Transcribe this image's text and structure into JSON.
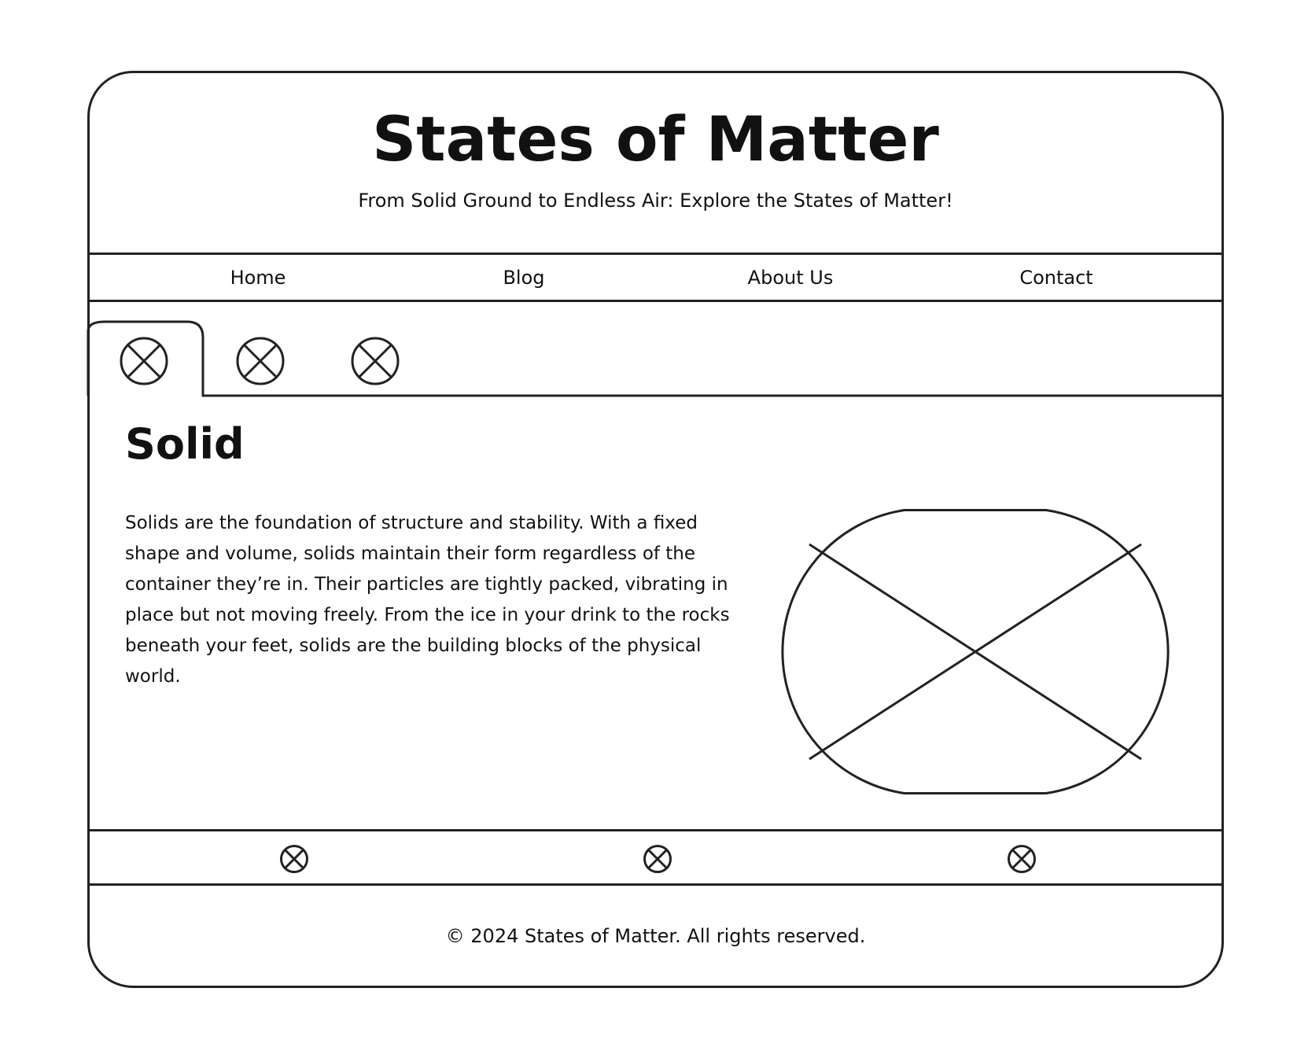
{
  "header": {
    "title": "States of Matter",
    "subtitle": "From Solid Ground to Endless Air: Explore the States of Matter!"
  },
  "nav": {
    "items": [
      {
        "label": "Home"
      },
      {
        "label": "Blog"
      },
      {
        "label": "About Us"
      },
      {
        "label": "Contact"
      }
    ]
  },
  "tabs": {
    "icons": [
      "placeholder-icon",
      "placeholder-icon",
      "placeholder-icon"
    ],
    "active_index": 0
  },
  "content": {
    "heading": "Solid",
    "body": "Solids are the foundation of structure and stability. With a fixed shape and volume, solids maintain their form regardless of the container they’re in. Their particles are tightly packed, vibrating in place but not moving freely. From the ice in your drink to the rocks beneath your feet, solids are the building blocks of the physical world.",
    "image_icon": "image-placeholder-icon"
  },
  "social": {
    "icons": [
      "placeholder-icon",
      "placeholder-icon",
      "placeholder-icon"
    ]
  },
  "footer": {
    "text": "© 2024 States of Matter. All rights reserved."
  },
  "colors": {
    "stroke": "#222222",
    "text": "#111111",
    "background": "#ffffff"
  }
}
